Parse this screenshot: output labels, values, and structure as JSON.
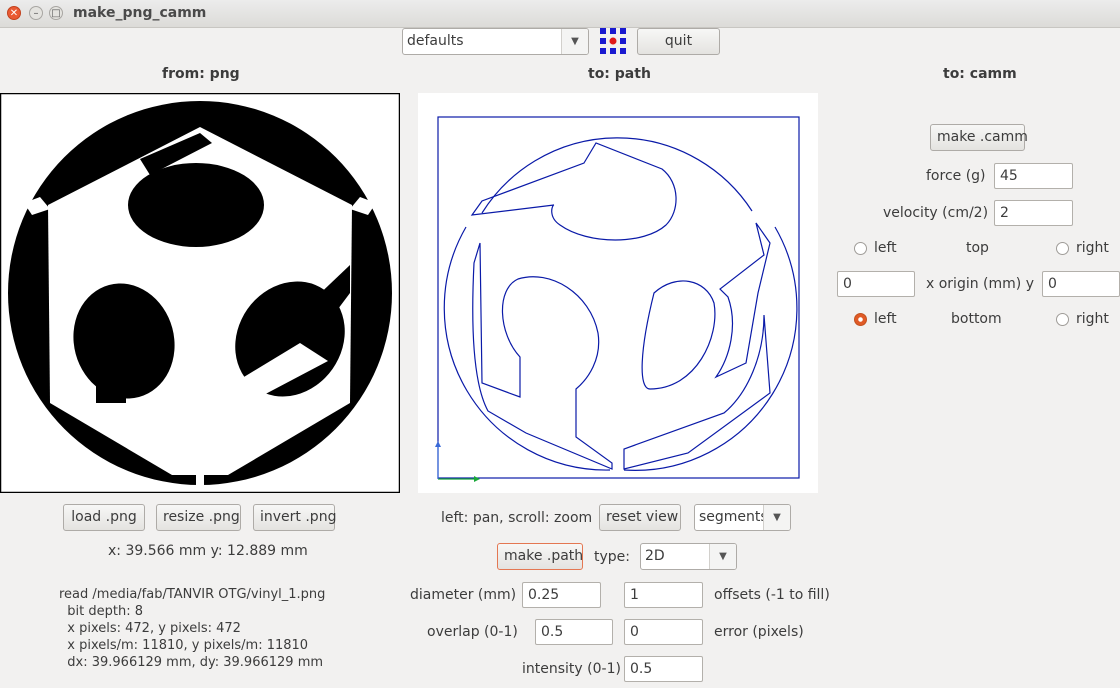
{
  "window": {
    "title": "make_png_camm"
  },
  "toolbar": {
    "preset_value": "defaults",
    "quit_label": "quit"
  },
  "headers": {
    "from": "from: png",
    "to_path": "to: path",
    "to_camm": "to: camm"
  },
  "png_panel": {
    "load_label": "load .png",
    "resize_label": "resize .png",
    "invert_label": "invert .png",
    "coords": "x: 39.566 mm  y: 12.889 mm",
    "info_lines": [
      "read /media/fab/TANVIR OTG/vinyl_1.png",
      "  bit depth: 8",
      "  x pixels: 472, y pixels: 472",
      "  x pixels/m: 11810, y pixels/m: 11810",
      "  dx: 39.966129 mm, dy: 39.966129 mm"
    ]
  },
  "path_panel": {
    "hint": "left: pan, scroll: zoom",
    "reset_view_label": "reset view",
    "view_mode_value": "segments",
    "make_path_label": "make .path",
    "type_label": "type:",
    "type_value": "2D",
    "diameter_label": "diameter (mm)",
    "diameter_value": "0.25",
    "offsets_value": "1",
    "offsets_label": "offsets (-1 to fill)",
    "overlap_label": "overlap (0-1)",
    "overlap_value": "0.5",
    "error_value": "0",
    "error_label": "error (pixels)",
    "intensity_label": "intensity (0-1)",
    "intensity_value": "0.5"
  },
  "camm_panel": {
    "make_camm_label": "make .camm",
    "force_label": "force (g)",
    "force_value": "45",
    "velocity_label": "velocity (cm/2)",
    "velocity_value": "2",
    "left_label": "left",
    "top_label": "top",
    "right_label": "right",
    "x_origin_value": "0",
    "origin_label": "x  origin (mm)  y",
    "y_origin_value": "0",
    "bottom_left_label": "left",
    "bottom_label": "bottom",
    "bottom_right_label": "right",
    "selected_origin": "left bottom"
  },
  "colors": {
    "path_stroke": "#0a1aa8",
    "axis_x": "#1aa83a",
    "axis_y": "#3a6ad8",
    "focus_border": "#e47752"
  }
}
